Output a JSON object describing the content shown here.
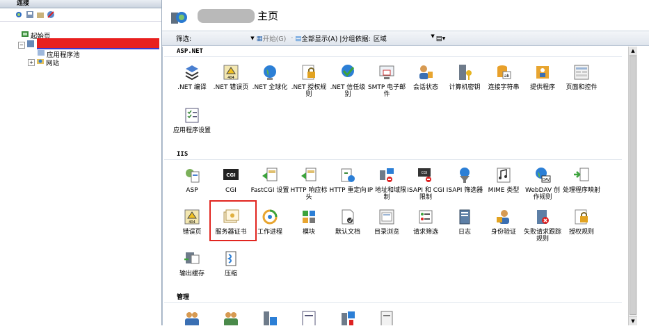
{
  "connections": {
    "header": "连接",
    "tree": [
      {
        "label": "起始页"
      },
      {
        "label": "应用程序池"
      },
      {
        "label": "网站"
      }
    ]
  },
  "main": {
    "title": "主页",
    "filter": {
      "label": "筛选:",
      "go_label": "开始(G)",
      "show_all_label": "全部显示(A)",
      "group_by_label": "|分组依据:",
      "group_by_value": "区域"
    },
    "sections": [
      {
        "name": "ASP.NET",
        "items": [
          {
            "label": ".NET 编译"
          },
          {
            "label": ".NET 错误页"
          },
          {
            "label": ".NET 全球化"
          },
          {
            "label": ".NET 授权规则"
          },
          {
            "label": ".NET 信任级别"
          },
          {
            "label": "SMTP 电子邮件"
          },
          {
            "label": "会话状态"
          },
          {
            "label": "计算机密钥"
          },
          {
            "label": "连接字符串"
          },
          {
            "label": "提供程序"
          },
          {
            "label": "页面和控件"
          },
          {
            "label": "应用程序设置"
          }
        ]
      },
      {
        "name": "IIS",
        "items": [
          {
            "label": "ASP"
          },
          {
            "label": "CGI"
          },
          {
            "label": "FastCGI 设置"
          },
          {
            "label": "HTTP 响应标头"
          },
          {
            "label": "HTTP 重定向"
          },
          {
            "label": "IP 地址和域限制"
          },
          {
            "label": "ISAPI 和 CGI 限制"
          },
          {
            "label": "ISAPI 筛选器"
          },
          {
            "label": "MIME 类型"
          },
          {
            "label": "WebDAV 创作规则"
          },
          {
            "label": "处理程序映射"
          },
          {
            "label": "错误页"
          },
          {
            "label": "服务器证书"
          },
          {
            "label": "工作进程"
          },
          {
            "label": "模块"
          },
          {
            "label": "默认文档"
          },
          {
            "label": "目录浏览"
          },
          {
            "label": "请求筛选"
          },
          {
            "label": "日志"
          },
          {
            "label": "身份验证"
          },
          {
            "label": "失败请求跟踪规则"
          },
          {
            "label": "授权规则"
          },
          {
            "label": "输出缓存"
          },
          {
            "label": "压缩"
          }
        ]
      },
      {
        "name": "管理",
        "items": []
      }
    ]
  },
  "colors": {
    "highlight": "#e1251f",
    "redaction": "#e8201f"
  }
}
